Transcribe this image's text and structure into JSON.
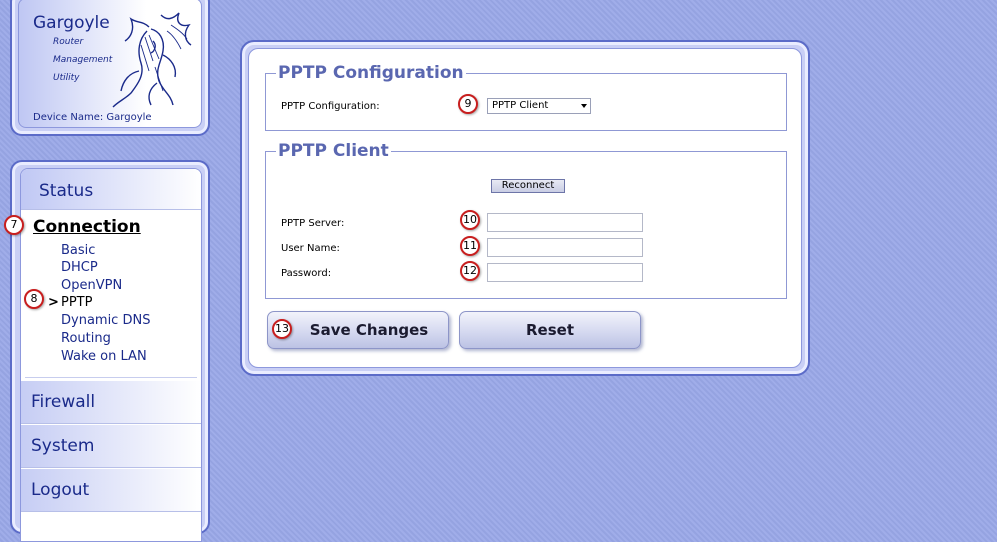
{
  "header": {
    "title": "Gargoyle",
    "subtitle_lines": [
      "Router",
      "Management",
      "Utility"
    ],
    "device_name": "Device Name: Gargoyle"
  },
  "nav": {
    "status": "Status",
    "connection": "Connection",
    "connection_items": [
      "Basic",
      "DHCP",
      "OpenVPN",
      "PPTP",
      "Dynamic DNS",
      "Routing",
      "Wake on LAN"
    ],
    "active_item_marker": ">",
    "firewall": "Firewall",
    "system": "System",
    "logout": "Logout"
  },
  "pptp_config": {
    "legend": "PPTP Configuration",
    "label": "PPTP Configuration:",
    "selected": "PPTP Client"
  },
  "pptp_client": {
    "legend": "PPTP Client",
    "reconnect_label": "Reconnect",
    "server_label": "PPTP Server:",
    "server_value": "",
    "username_label": "User Name:",
    "username_value": "",
    "password_label": "Password:",
    "password_value": ""
  },
  "actions": {
    "save_label": "Save Changes",
    "reset_label": "Reset"
  },
  "markers": [
    "7",
    "8",
    "9",
    "10",
    "11",
    "12",
    "13"
  ],
  "colors": {
    "background": "#9aa8e8",
    "accent": "#5a67b0",
    "marker_border": "#c81e1e"
  }
}
